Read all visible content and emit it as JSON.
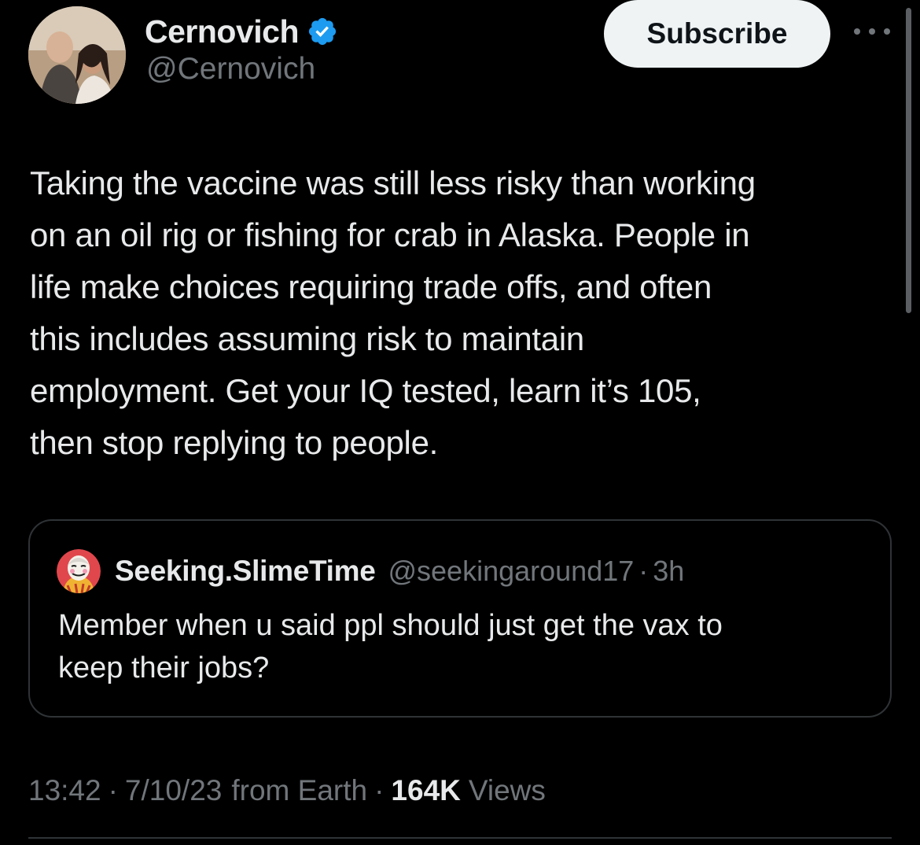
{
  "author": {
    "display_name": "Cernovich",
    "handle": "@Cernovich",
    "verified": true
  },
  "subscribe_button": {
    "label": "Subscribe"
  },
  "tweet": {
    "text": "Taking the vaccine was still less risky than working\non an oil rig or fishing for crab in Alaska. People in\nlife make choices requiring trade offs, and often\nthis includes assuming risk to maintain\nemployment. Get your IQ tested, learn it’s 105,\nthen stop replying to people."
  },
  "quoted_tweet": {
    "display_name": "Seeking.SlimeTime",
    "handle": "@seekingaround17",
    "separator": "·",
    "time": "3h",
    "text": "Member when u said ppl should just get the vax to\nkeep their jobs?"
  },
  "meta": {
    "time": "13:42",
    "separator": "·",
    "date": "7/10/23",
    "source": "from Earth",
    "views_count": "164K",
    "views_label": "Views"
  },
  "colors": {
    "background": "#000000",
    "text_primary": "#e7e9ea",
    "text_secondary": "#71767b",
    "verified_badge": "#1d9bf0",
    "border": "#2f3336",
    "button_bg": "#eff3f4"
  },
  "icons": {
    "verified": "verified-badge-icon",
    "more": "more-options-icon"
  }
}
